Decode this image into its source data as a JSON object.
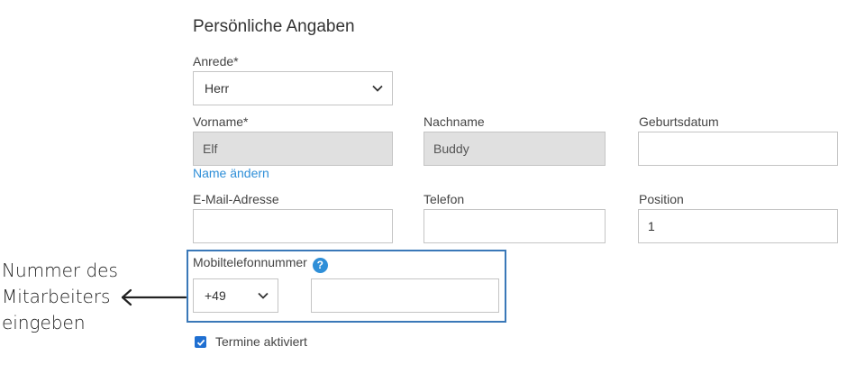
{
  "section": {
    "title": "Persönliche Angaben"
  },
  "anrede": {
    "label": "Anrede*",
    "value": "Herr"
  },
  "vorname": {
    "label": "Vorname*",
    "value": "Elf"
  },
  "nachname": {
    "label": "Nachname",
    "value": "Buddy"
  },
  "geburtsdatum": {
    "label": "Geburtsdatum",
    "value": ""
  },
  "name_change_link": "Name ändern",
  "email": {
    "label": "E-Mail-Adresse",
    "value": ""
  },
  "telefon": {
    "label": "Telefon",
    "value": ""
  },
  "position": {
    "label": "Position",
    "value": "1"
  },
  "mobile": {
    "label": "Mobiltelefonnummer",
    "help_icon": "?",
    "country_code": "+49",
    "number": ""
  },
  "termine": {
    "label": "Termine aktiviert",
    "checked": true
  },
  "annotation": {
    "lines": [
      "Nummer des",
      "Mitarbeiters",
      "eingeben"
    ]
  },
  "colors": {
    "accent": "#2f8fd8",
    "highlight_border": "#3a78b8",
    "checkbox": "#1f6fd1",
    "disabled_bg": "#e0e0e0"
  }
}
